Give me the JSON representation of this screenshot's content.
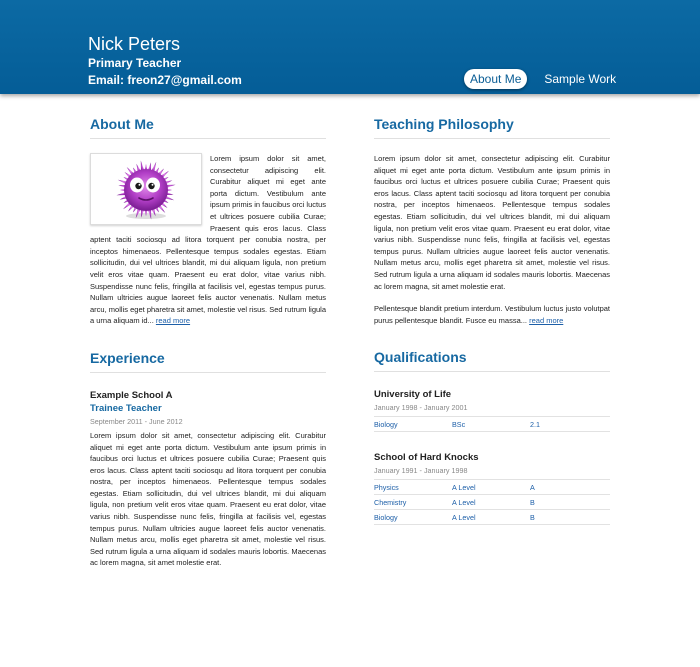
{
  "header": {
    "name": "Nick Peters",
    "role": "Primary Teacher",
    "email": "Email: freon27@gmail.com",
    "nav": [
      {
        "label": "About Me",
        "active": true
      },
      {
        "label": "Sample Work",
        "active": false
      }
    ]
  },
  "about": {
    "title": "About Me",
    "text": "Lorem ipsum dolor sit amet, consectetur adipiscing elit. Curabitur aliquet mi eget ante porta dictum. Vestibulum ante ipsum primis in faucibus orci luctus et ultrices posuere cubilia Curae; Praesent quis eros lacus. Class aptent taciti sociosqu ad litora torquent per conubia nostra, per inceptos himenaeos. Pellentesque tempus sodales egestas. Etiam sollicitudin, dui vel ultrices blandit, mi dui aliquam ligula, non pretium velit eros vitae quam. Praesent eu erat dolor, vitae varius nibh. Suspendisse nunc felis, fringilla at facilisis vel, egestas tempus purus. Nullam ultricies augue laoreet felis auctor venenatis. Nullam metus arcu, mollis eget pharetra sit amet, molestie vel risus. Sed rutrum ligula a urna aliquam id...",
    "read_more": "read more",
    "image_icon": "purple-fuzzy-monster-icon"
  },
  "philosophy": {
    "title": "Teaching Philosophy",
    "text1": "Lorem ipsum dolor sit amet, consectetur adipiscing elit. Curabitur aliquet mi eget ante porta dictum. Vestibulum ante ipsum primis in faucibus orci luctus et ultrices posuere cubilia Curae; Praesent quis eros lacus. Class aptent taciti sociosqu ad litora torquent per conubia nostra, per inceptos himenaeos. Pellentesque tempus sodales egestas. Etiam sollicitudin, dui vel ultrices blandit, mi dui aliquam ligula, non pretium velit eros vitae quam. Praesent eu erat dolor, vitae varius nibh. Suspendisse nunc felis, fringilla at facilisis vel, egestas tempus purus. Nullam ultricies augue laoreet felis auctor venenatis. Nullam metus arcu, mollis eget pharetra sit amet, molestie vel risus. Sed rutrum ligula a urna aliquam id sodales mauris lobortis. Maecenas ac lorem magna, sit amet molestie erat.",
    "text2": "Pellentesque blandit pretium interdum. Vestibulum luctus justo volutpat purus pellentesque blandit. Fusce eu massa...",
    "read_more": "read more"
  },
  "experience": {
    "title": "Experience",
    "items": [
      {
        "school": "Example School A",
        "role": "Trainee Teacher",
        "dates": "September 2011 - June 2012",
        "text": "Lorem ipsum dolor sit amet, consectetur adipiscing elit. Curabitur aliquet mi eget ante porta dictum. Vestibulum ante ipsum primis in faucibus orci luctus et ultrices posuere cubilia Curae; Praesent quis eros lacus. Class aptent taciti sociosqu ad litora torquent per conubia nostra, per inceptos himenaeos. Pellentesque tempus sodales egestas. Etiam sollicitudin, dui vel ultrices blandit, mi dui aliquam ligula, non pretium velit eros vitae quam. Praesent eu erat dolor, vitae varius nibh. Suspendisse nunc felis, fringilla at facilisis vel, egestas tempus purus. Nullam ultricies augue laoreet felis auctor venenatis. Nullam metus arcu, mollis eget pharetra sit amet, molestie vel risus. Sed rutrum ligula a urna aliquam id sodales mauris lobortis. Maecenas ac lorem magna, sit amet molestie erat."
      }
    ]
  },
  "qualifications": {
    "title": "Qualifications",
    "items": [
      {
        "school": "University of Life",
        "dates": "January 1998 - January 2001",
        "rows": [
          [
            "Biology",
            "BSc",
            "2.1"
          ]
        ]
      },
      {
        "school": "School of Hard Knocks",
        "dates": "January 1991 - January 1998",
        "rows": [
          [
            "Physics",
            "A Level",
            "A"
          ],
          [
            "Chemistry",
            "A Level",
            "B"
          ],
          [
            "Biology",
            "A Level",
            "B"
          ]
        ]
      }
    ]
  },
  "colors": {
    "header_blue": "#0a63a0",
    "heading_blue": "#1769a2",
    "link_blue": "#1d5fa8",
    "monster_purple": "#b23fc7"
  }
}
